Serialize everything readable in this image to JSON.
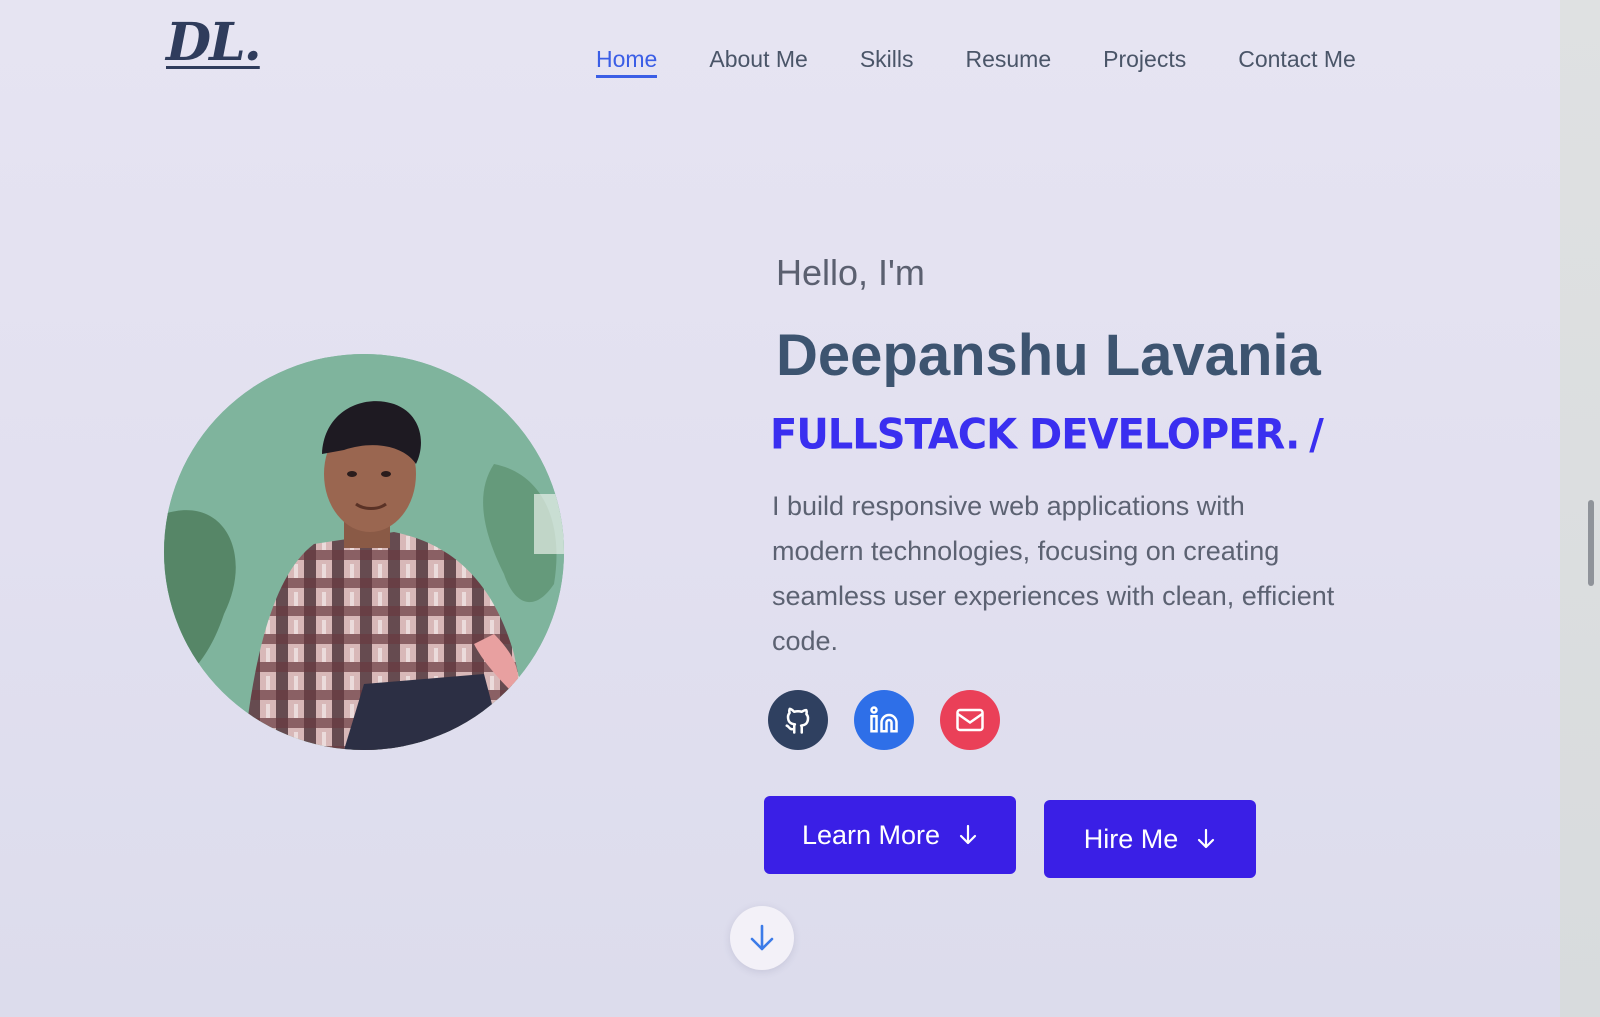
{
  "brand": {
    "logo_text": "DL."
  },
  "nav": {
    "items": [
      {
        "label": "Home",
        "active": true
      },
      {
        "label": "About Me",
        "active": false
      },
      {
        "label": "Skills",
        "active": false
      },
      {
        "label": "Resume",
        "active": false
      },
      {
        "label": "Projects",
        "active": false
      },
      {
        "label": "Contact Me",
        "active": false
      }
    ]
  },
  "hero": {
    "greeting": "Hello, I'm",
    "name": "Deepanshu Lavania",
    "role": "FULLSTACK DEVELOPER.",
    "role_cursor": "/",
    "bio": "I build responsive web applications with modern technologies, focusing on creating seamless user experiences with clean, efficient code.",
    "social": [
      {
        "name": "github",
        "icon": "github-icon",
        "color": "#2f4060"
      },
      {
        "name": "linkedin",
        "icon": "linkedin-icon",
        "color": "#2e6fe8"
      },
      {
        "name": "email",
        "icon": "mail-icon",
        "color": "#ea4058"
      }
    ],
    "buttons": {
      "learn_more": "Learn More",
      "hire_me": "Hire Me"
    }
  },
  "colors": {
    "accent": "#3a1fe6",
    "nav_active": "#3b5ee6",
    "name": "#3d5470"
  }
}
